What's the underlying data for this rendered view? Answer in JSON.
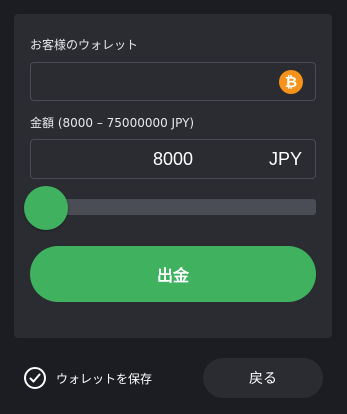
{
  "wallet": {
    "label": "お客様のウォレット",
    "value": "",
    "placeholder": "",
    "currency_icon": "bitcoin-icon",
    "icon_glyph": "₿",
    "icon_color": "#f7931a"
  },
  "amount": {
    "label": "金額 (8000 – 75000000 JPY)",
    "value": "8000",
    "currency": "JPY",
    "min": 8000,
    "max": 75000000
  },
  "slider": {
    "value": 8000,
    "fraction": 0
  },
  "actions": {
    "withdraw_label": "出金",
    "save_wallet_label": "ウォレットを保存",
    "save_wallet_checked": true,
    "back_label": "戻る"
  },
  "colors": {
    "accent": "#3fb15f",
    "background": "#1c1d22",
    "panel": "#2a2c32",
    "bitcoin": "#f7931a"
  }
}
